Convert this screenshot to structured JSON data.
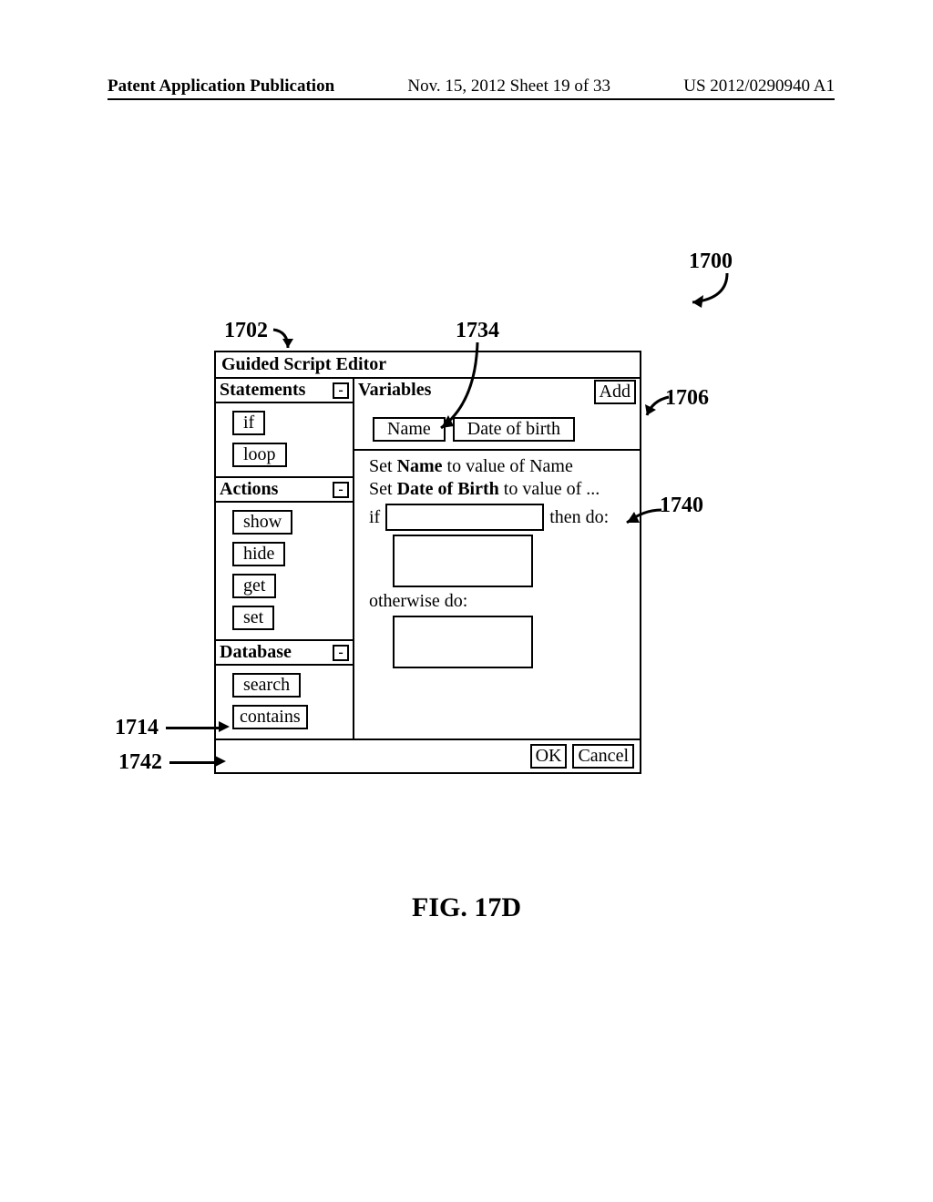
{
  "header": {
    "left": "Patent Application Publication",
    "mid": "Nov. 15, 2012  Sheet 19 of 33",
    "right": "US 2012/0290940 A1"
  },
  "refs": {
    "r1700": "1700",
    "r1702": "1702",
    "r1734": "1734",
    "r1706": "1706",
    "r1740": "1740",
    "r1714": "1714",
    "r1742": "1742"
  },
  "editor": {
    "title": "Guided Script Editor",
    "sections": {
      "statements": {
        "label": "Statements",
        "items": [
          "if",
          "loop"
        ]
      },
      "actions": {
        "label": "Actions",
        "items": [
          "show",
          "hide",
          "get",
          "set"
        ]
      },
      "database": {
        "label": "Database",
        "items": [
          "search",
          "contains"
        ]
      }
    },
    "collapse_glyph": "-",
    "variables": {
      "label": "Variables",
      "add_label": "Add",
      "chips": [
        "Name",
        "Date of birth"
      ]
    },
    "script": {
      "line1_pre": "Set ",
      "line1_bold": "Name",
      "line1_post": " to value of Name",
      "line2_pre": "Set ",
      "line2_bold": "Date of Birth",
      "line2_post": " to value of ...",
      "if_kw": "if",
      "then_kw": "then do:",
      "else_kw": "otherwise do:"
    },
    "footer": {
      "ok": "OK",
      "cancel": "Cancel"
    }
  },
  "figure_caption": "FIG. 17D"
}
